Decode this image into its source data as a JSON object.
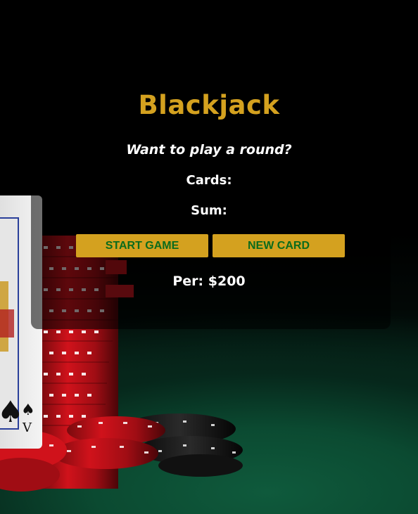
{
  "game": {
    "title": "Blackjack",
    "message": "Want to play a round?",
    "cards_label": "Cards:",
    "sum_label": "Sum:",
    "player_info": "Per: $200"
  },
  "buttons": {
    "start_game": "START GAME",
    "new_card": "NEW CARD"
  },
  "colors": {
    "title": "#d4a11f",
    "button_bg": "#d4a11f",
    "button_text": "#0b6b1c",
    "text": "#ffffff",
    "felt": "#0b4a31"
  },
  "background": {
    "icon": "casino-chips-and-cards"
  }
}
